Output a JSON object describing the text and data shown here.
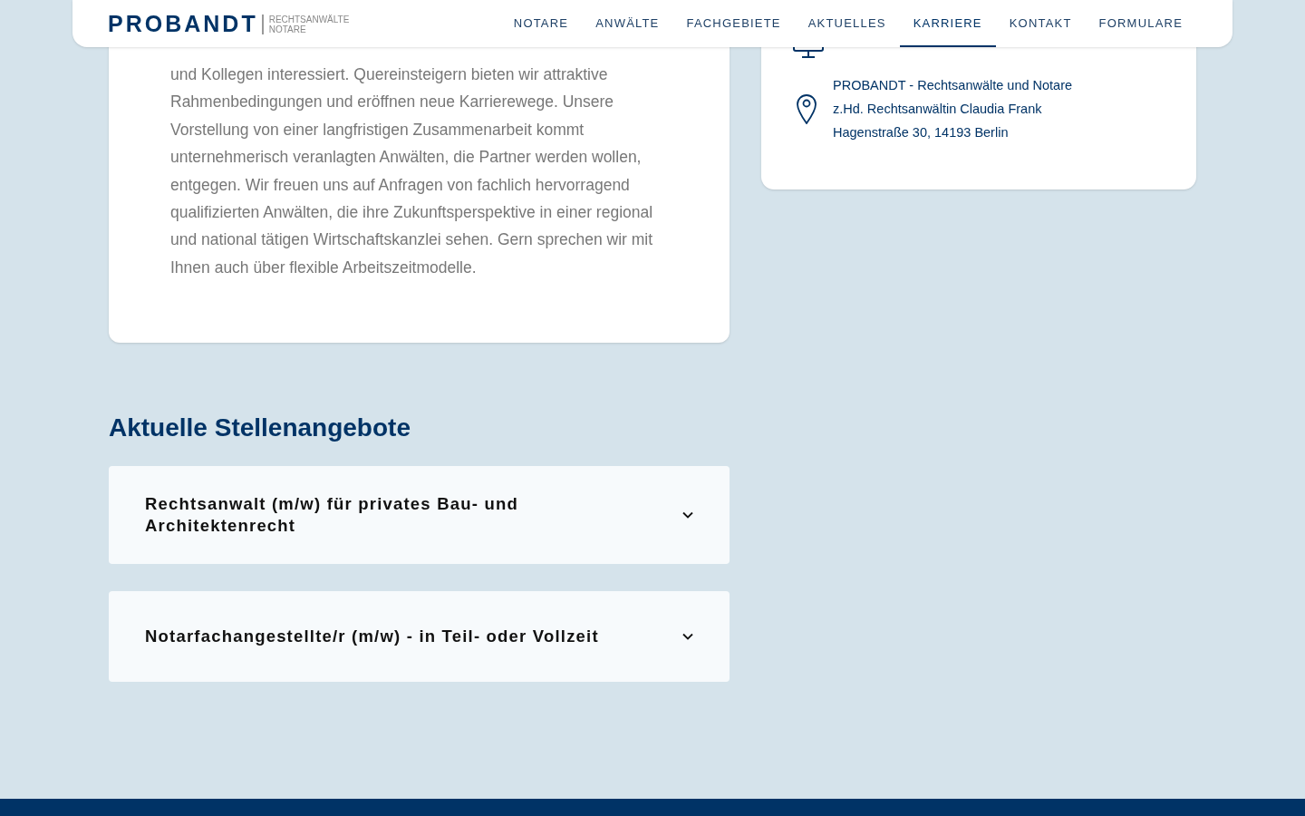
{
  "header": {
    "logo": {
      "name": "PROBANDT",
      "tagline": [
        "RECHTSANWÄLTE",
        "NOTARE"
      ]
    },
    "nav": [
      {
        "label": "NOTARE",
        "selected": false
      },
      {
        "label": "ANWÄLTE",
        "selected": false
      },
      {
        "label": "FACHGEBIETE",
        "selected": false
      },
      {
        "label": "AKTUELLES",
        "selected": false
      },
      {
        "label": "KARRIERE",
        "selected": true
      },
      {
        "label": "KONTAKT",
        "selected": false
      },
      {
        "label": "FORMULARE",
        "selected": false
      }
    ]
  },
  "intro_card": {
    "paragraph": "und Kollegen interessiert. Quereinsteigern bieten wir attraktive Rahmenbedingungen und eröffnen neue Karrierewege. Unsere Vorstellung von einer langfristigen Zusammenarbeit kommt unternehmerisch veranlagten Anwälten, die Partner werden wollen, entgegen. Wir freuen uns auf Anfragen von fachlich hervorragend qualifizierten Anwälten, die ihre Zukunftsperspektive in einer regional und national tätigen Wirtschaftskanzlei sehen. Gern sprechen wir mit Ihnen auch über flexible Arbeitszeitmodelle."
  },
  "contact_card": {
    "address_lines": [
      "PROBANDT - Rechtsanwälte und Notare",
      "z.Hd. Rechtsanwältin Claudia Frank",
      "Hagenstraße 30, 14193 Berlin"
    ]
  },
  "jobs": {
    "heading": "Aktuelle Stellenangebote",
    "items": [
      {
        "title": "Rechtsanwalt (m/w) für privates Bau- und Architektenrecht",
        "expanded": false
      },
      {
        "title": "Notarfachangestellte/r (m/w) - in Teil- oder Vollzeit",
        "expanded": false
      }
    ]
  }
}
